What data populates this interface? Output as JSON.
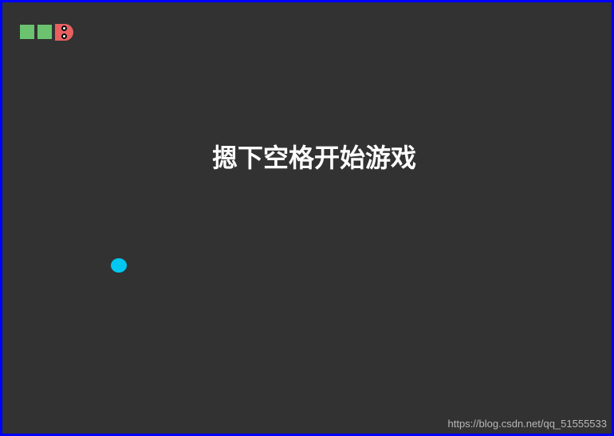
{
  "game": {
    "message": "摁下空格开始游戏",
    "snake": {
      "body_color": "#6cc36f",
      "head_color": "#e85f5f",
      "segments": 2
    },
    "food": {
      "color": "#00c8f0"
    }
  },
  "frame": {
    "border_color": "#0000ff",
    "background_color": "#323232"
  },
  "watermark": "https://blog.csdn.net/qq_51555533"
}
